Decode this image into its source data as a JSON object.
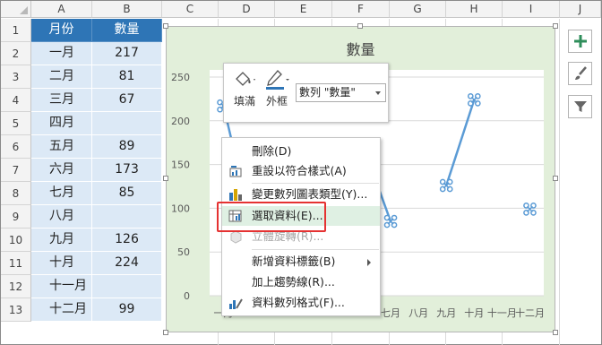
{
  "spreadsheet": {
    "columns": [
      "A",
      "B",
      "C",
      "D",
      "E",
      "F",
      "G",
      "H",
      "I",
      "J"
    ],
    "rows": [
      "1",
      "2",
      "3",
      "4",
      "5",
      "6",
      "7",
      "8",
      "9",
      "10",
      "11",
      "12",
      "13"
    ],
    "header": {
      "month": "月份",
      "amount": "數量"
    },
    "data": [
      {
        "month": "一月",
        "amount": "217"
      },
      {
        "month": "二月",
        "amount": "81"
      },
      {
        "month": "三月",
        "amount": "67"
      },
      {
        "month": "四月",
        "amount": ""
      },
      {
        "month": "五月",
        "amount": "89"
      },
      {
        "month": "六月",
        "amount": "173"
      },
      {
        "month": "七月",
        "amount": "85"
      },
      {
        "month": "八月",
        "amount": ""
      },
      {
        "month": "九月",
        "amount": "126"
      },
      {
        "month": "十月",
        "amount": "224"
      },
      {
        "month": "十一月",
        "amount": ""
      },
      {
        "month": "十二月",
        "amount": "99"
      }
    ]
  },
  "chart_data": {
    "type": "line",
    "title": "數量",
    "categories": [
      "一月",
      "二月",
      "三月",
      "四月",
      "五月",
      "六月",
      "七月",
      "八月",
      "九月",
      "十月",
      "十一月",
      "十二月"
    ],
    "visible_category_labels": [
      "一月",
      "七月",
      "八月",
      "九月",
      "十月",
      "十一月",
      "十二月"
    ],
    "series": [
      {
        "name": "數量",
        "values": [
          217,
          81,
          67,
          null,
          89,
          173,
          85,
          null,
          126,
          224,
          null,
          99
        ]
      }
    ],
    "ylim": [
      0,
      250
    ],
    "yticks": [
      "0",
      "50",
      "100",
      "150",
      "200",
      "250"
    ],
    "grid": true,
    "background": "#e2efda",
    "line_color": "#5b9bd5"
  },
  "minitoolbar": {
    "fill_label": "填滿",
    "outline_label": "外框",
    "series_selector": "數列 \"數量\""
  },
  "context_menu": {
    "items": [
      {
        "label": "刪除(D)",
        "icon": "none",
        "state": "normal"
      },
      {
        "label": "重設以符合樣式(A)",
        "icon": "reset-style-icon",
        "state": "normal"
      },
      {
        "label": "變更數列圖表類型(Y)...",
        "icon": "chart-type-icon",
        "state": "normal"
      },
      {
        "label": "選取資料(E)...",
        "icon": "select-data-icon",
        "state": "highlighted"
      },
      {
        "label": "立體旋轉(R)...",
        "icon": "3d-rotation-icon",
        "state": "disabled"
      },
      {
        "label": "新增資料標籤(B)",
        "icon": "none",
        "state": "submenu"
      },
      {
        "label": "加上趨勢線(R)...",
        "icon": "none",
        "state": "normal"
      },
      {
        "label": "資料數列格式(F)...",
        "icon": "format-series-icon",
        "state": "normal"
      }
    ]
  },
  "accent_colors": {
    "table_header": "#2e75b6",
    "table_band": "#dce9f6",
    "highlight": "#e53232"
  }
}
